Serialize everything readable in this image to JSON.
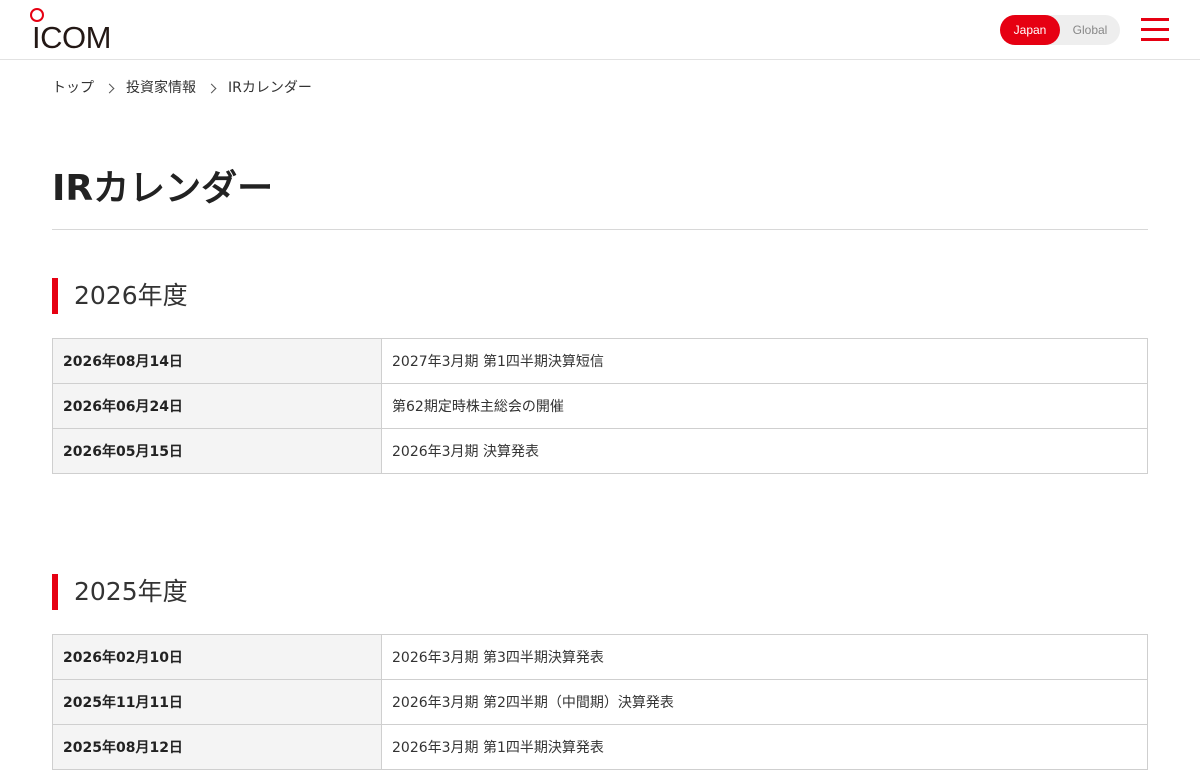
{
  "header": {
    "logo_text": "ICOM",
    "lang_japan": "Japan",
    "lang_global": "Global",
    "colors": {
      "accent": "#e60012",
      "logo_text": "#231815"
    },
    "icons": {
      "menu": "hamburger-menu-icon"
    }
  },
  "breadcrumb": [
    {
      "label": "トップ"
    },
    {
      "label": "投資家情報"
    },
    {
      "label": "IRカレンダー"
    }
  ],
  "page_title": "IRカレンダー",
  "sections": [
    {
      "title": "2026年度",
      "rows": [
        {
          "date": "2026年08月14日",
          "event": "2027年3月期 第1四半期決算短信"
        },
        {
          "date": "2026年06月24日",
          "event": "第62期定時株主総会の開催"
        },
        {
          "date": "2026年05月15日",
          "event": "2026年3月期 決算発表"
        }
      ]
    },
    {
      "title": "2025年度",
      "rows": [
        {
          "date": "2026年02月10日",
          "event": "2026年3月期 第3四半期決算発表"
        },
        {
          "date": "2025年11月11日",
          "event": "2026年3月期 第2四半期（中間期）決算発表"
        },
        {
          "date": "2025年08月12日",
          "event": "2026年3月期 第1四半期決算発表"
        }
      ]
    }
  ]
}
